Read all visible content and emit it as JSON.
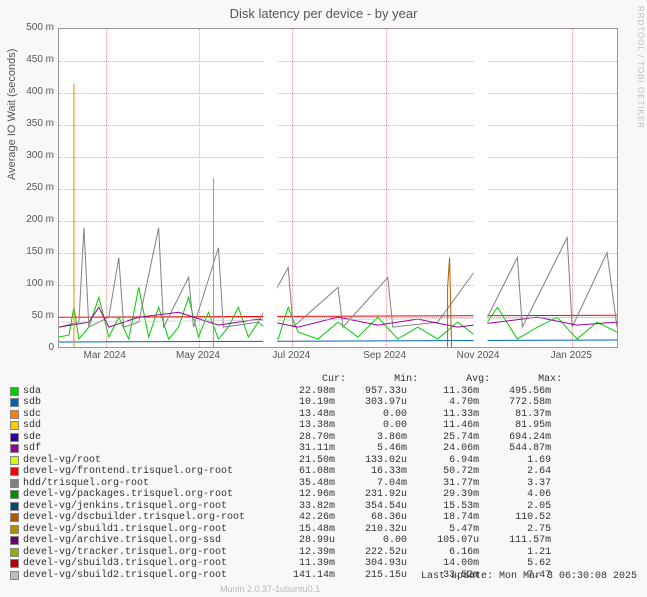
{
  "title": "Disk latency per device - by year",
  "ylabel": "Average IO Wait (seconds)",
  "watermark": "RRDTOOL / TOBI OETIKER",
  "footer_tool": "Munin 2.0.37-1ubuntu0.1",
  "footer_update": "Last update: Mon Mar  3 06:30:08 2025",
  "chart_data": {
    "type": "line",
    "title": "Disk latency per device - by year",
    "ylabel": "Average IO Wait (seconds)",
    "ylim": [
      0,
      0.5
    ],
    "yticks": [
      0,
      0.05,
      0.1,
      0.15,
      0.2,
      0.25,
      0.3,
      0.35,
      0.4,
      0.45,
      0.5
    ],
    "ytick_labels": [
      "0",
      "50 m",
      "100 m",
      "150 m",
      "200 m",
      "250 m",
      "300 m",
      "350 m",
      "400 m",
      "450 m",
      "500 m"
    ],
    "x_categories": [
      "Mar 2024",
      "May 2024",
      "Jul 2024",
      "Sep 2024",
      "Nov 2024",
      "Jan 2025"
    ],
    "series": [
      {
        "name": "sda",
        "color": "#00cc00",
        "cur": "22.98m",
        "min": "957.33u",
        "avg": "11.36m",
        "max": "495.56m"
      },
      {
        "name": "sdb",
        "color": "#0066b3",
        "cur": "10.19m",
        "min": "303.97u",
        "avg": "4.70m",
        "max": "772.58m"
      },
      {
        "name": "sdc",
        "color": "#ff8000",
        "cur": "13.48m",
        "min": "0.00",
        "avg": "11.33m",
        "max": "81.37m"
      },
      {
        "name": "sdd",
        "color": "#ffcc00",
        "cur": "13.38m",
        "min": "0.00",
        "avg": "11.46m",
        "max": "81.95m"
      },
      {
        "name": "sde",
        "color": "#330099",
        "cur": "28.70m",
        "min": "3.86m",
        "avg": "25.74m",
        "max": "694.24m"
      },
      {
        "name": "sdf",
        "color": "#990099",
        "cur": "31.11m",
        "min": "5.46m",
        "avg": "24.06m",
        "max": "544.87m"
      },
      {
        "name": "devel-vg/root",
        "color": "#ccff00",
        "cur": "21.50m",
        "min": "133.02u",
        "avg": "6.94m",
        "max": "1.69"
      },
      {
        "name": "devel-vg/frontend.trisquel.org-root",
        "color": "#ff0000",
        "cur": "61.08m",
        "min": "16.33m",
        "avg": "50.72m",
        "max": "2.64"
      },
      {
        "name": "hdd/trisquel.org-root",
        "color": "#808080",
        "cur": "35.48m",
        "min": "7.04m",
        "avg": "31.77m",
        "max": "3.37"
      },
      {
        "name": "devel-vg/packages.trisquel.org-root",
        "color": "#008f00",
        "cur": "12.96m",
        "min": "231.92u",
        "avg": "29.39m",
        "max": "4.06"
      },
      {
        "name": "devel-vg/jenkins.trisquel.org-root",
        "color": "#00487d",
        "cur": "33.82m",
        "min": "354.54u",
        "avg": "15.53m",
        "max": "2.05"
      },
      {
        "name": "devel-vg/dscbuilder.trisquel.org-root",
        "color": "#b35a00",
        "cur": "42.26m",
        "min": "68.36u",
        "avg": "18.74m",
        "max": "110.52"
      },
      {
        "name": "devel-vg/sbuild1.trisquel.org-root",
        "color": "#b38f00",
        "cur": "15.48m",
        "min": "210.32u",
        "avg": "5.47m",
        "max": "2.75"
      },
      {
        "name": "devel-vg/archive.trisquel.org-ssd",
        "color": "#6b006b",
        "cur": "28.99u",
        "min": "0.00",
        "avg": "105.07u",
        "max": "111.57m"
      },
      {
        "name": "devel-vg/tracker.trisquel.org-root",
        "color": "#8fb300",
        "cur": "12.39m",
        "min": "222.52u",
        "avg": "6.16m",
        "max": "1.21"
      },
      {
        "name": "devel-vg/sbuild3.trisquel.org-root",
        "color": "#b30000",
        "cur": "11.39m",
        "min": "304.93u",
        "avg": "14.00m",
        "max": "5.62"
      },
      {
        "name": "devel-vg/sbuild2.trisquel.org-root",
        "color": "#bebebe",
        "cur": "141.14m",
        "min": "215.15u",
        "avg": "33.52m",
        "max": "7.47"
      }
    ]
  }
}
